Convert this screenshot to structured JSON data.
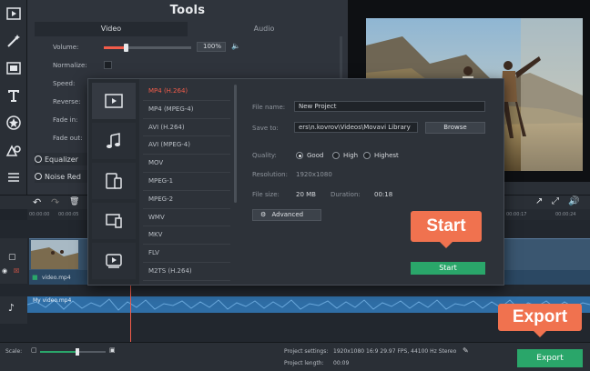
{
  "tools": {
    "title": "Tools",
    "tabs": [
      {
        "label": "Video"
      },
      {
        "label": "Audio"
      }
    ],
    "rows": {
      "volume": "Volume:",
      "volume_value": "100%",
      "normalize": "Normalize:",
      "speed": "Speed:",
      "reverse": "Reverse:",
      "fade_in": "Fade in:",
      "fade_out": "Fade out:"
    },
    "options": [
      "Equalizer",
      "Noise Red"
    ]
  },
  "export_dialog": {
    "formats": [
      "MP4 (H.264)",
      "MP4 (MPEG-4)",
      "AVI (H.264)",
      "AVI (MPEG-4)",
      "MOV",
      "MPEG-1",
      "MPEG-2",
      "WMV",
      "MKV",
      "FLV",
      "M2TS (H.264)"
    ],
    "selected_format": "MP4 (H.264)",
    "file_name_label": "File name:",
    "file_name_value": "New Project",
    "save_to_label": "Save to:",
    "save_to_value": "ers\\n.kovrov\\Videos\\Movavi Library",
    "browse_label": "Browse",
    "quality_label": "Quality:",
    "quality_options": [
      "Good",
      "High",
      "Highest"
    ],
    "quality_selected": "Good",
    "resolution_label": "Resolution:",
    "resolution_value": "1920x1080",
    "file_size_label": "File size:",
    "file_size_value": "20 MB",
    "duration_label": "Duration:",
    "duration_value": "00:18",
    "advanced_label": "Advanced",
    "start_label": "Start"
  },
  "timeline": {
    "ruler_ticks": [
      "00:00:00",
      "00:00:05",
      "00:00:17",
      "00:00:24"
    ],
    "video_clip_label": "video.mp4",
    "audio_clip_label": "My video.mp4"
  },
  "status": {
    "scale_label": "Scale:",
    "project_settings_label": "Project settings:",
    "project_settings_value": "1920x1080 16:9 29.97 FPS, 44100 Hz Stereo",
    "project_length_label": "Project length:",
    "project_length_value": "00:09",
    "export_label": "Export"
  },
  "callouts": {
    "start": "Start",
    "export": "Export"
  },
  "colors": {
    "accent": "#f25c4a",
    "callout": "#f0724f",
    "green": "#2aa66a",
    "clip_blue": "#2f6ea6"
  }
}
